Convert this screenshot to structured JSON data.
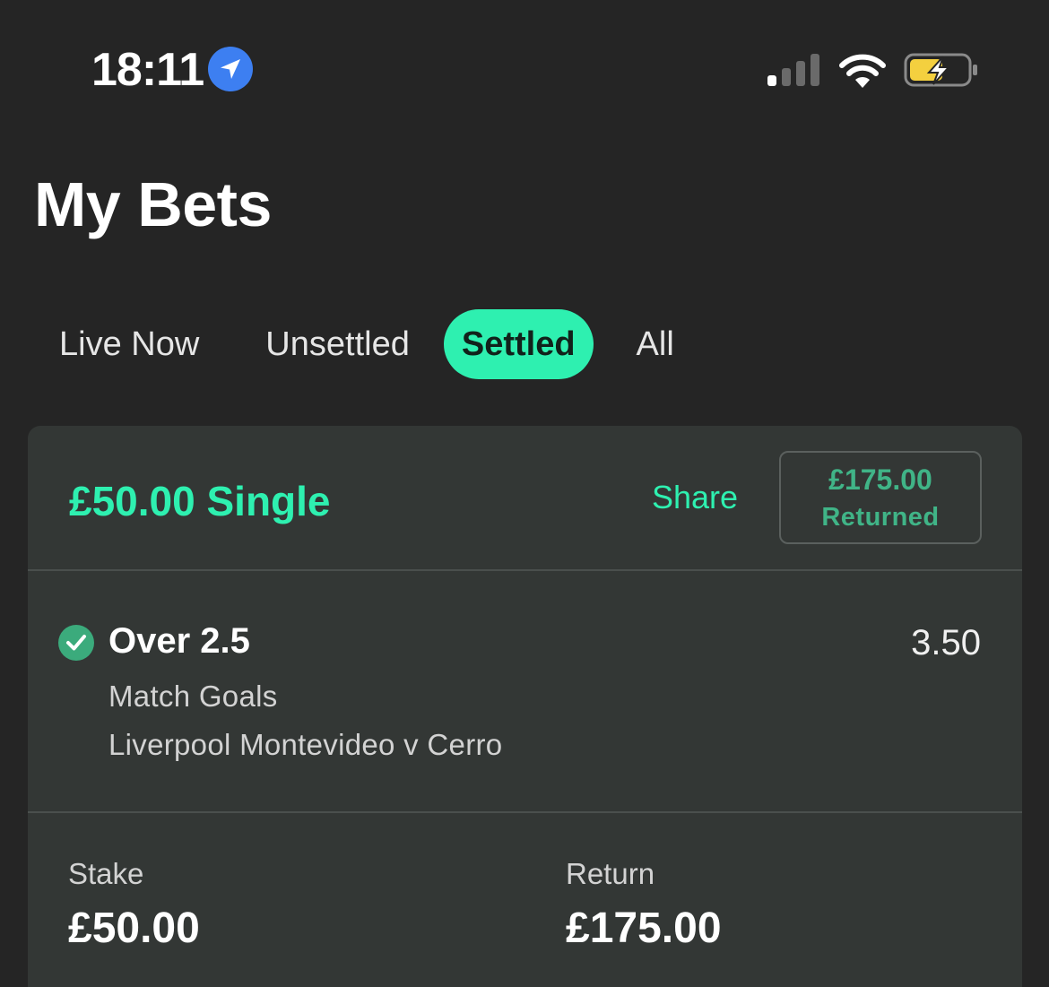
{
  "status_bar": {
    "time": "18:11",
    "icons": [
      "location-arrow-icon",
      "cellular-signal-icon",
      "wifi-icon",
      "battery-charging-icon"
    ]
  },
  "header": {
    "title": "My Bets"
  },
  "tabs": [
    {
      "label": "Live Now",
      "active": false
    },
    {
      "label": "Unsettled",
      "active": false
    },
    {
      "label": "Settled",
      "active": true
    },
    {
      "label": "All",
      "active": false
    }
  ],
  "bet": {
    "title": "£50.00 Single",
    "share_label": "Share",
    "returned_amount": "£175.00",
    "returned_label": "Returned",
    "selection": {
      "name": "Over 2.5",
      "odds": "3.50",
      "market": "Match Goals",
      "event": "Liverpool Montevideo v Cerro",
      "status_icon": "check-circle-icon"
    },
    "stake_label": "Stake",
    "stake_value": "£50.00",
    "return_label": "Return",
    "return_value": "£175.00"
  },
  "colors": {
    "background": "#252525",
    "card": "#333735",
    "accent": "#2ef0b0",
    "returned_text": "#40b487",
    "win_check": "#3bab7c",
    "location": "#3d7ff1",
    "battery_fill": "#f4d03f"
  }
}
